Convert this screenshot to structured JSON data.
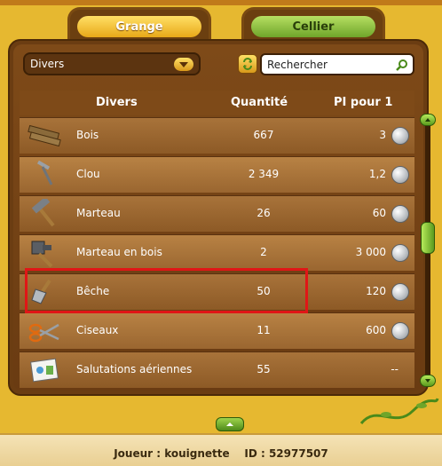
{
  "tabs": [
    {
      "label": "Grange",
      "active": true
    },
    {
      "label": "Cellier",
      "active": false
    }
  ],
  "filter": {
    "selected": "Divers"
  },
  "search": {
    "placeholder": "Rechercher"
  },
  "table": {
    "headers": {
      "name": "Divers",
      "quantity": "Quantité",
      "price": "PI pour 1"
    },
    "rows": [
      {
        "name": "Bois",
        "quantity": "667",
        "price": "3",
        "icon": "wood-planks-icon"
      },
      {
        "name": "Clou",
        "quantity": "2 349",
        "price": "1,2",
        "icon": "nail-icon"
      },
      {
        "name": "Marteau",
        "quantity": "26",
        "price": "60",
        "icon": "hammer-icon"
      },
      {
        "name": "Marteau en bois",
        "quantity": "2",
        "price": "3 000",
        "icon": "mallet-icon"
      },
      {
        "name": "Bêche",
        "quantity": "50",
        "price": "120",
        "icon": "spade-icon",
        "highlighted": true
      },
      {
        "name": "Ciseaux",
        "quantity": "11",
        "price": "600",
        "icon": "scissors-icon"
      },
      {
        "name": "Salutations aériennes",
        "quantity": "55",
        "price": "--",
        "icon": "postcard-icon"
      }
    ]
  },
  "scrollbar": {
    "position": 0.4
  },
  "footer": {
    "player_text": "Joueur : kouignette    ID : 52977507"
  },
  "colors": {
    "highlight": "#e01616",
    "wood_dark": "#6b3d12",
    "gold": "#e6b830",
    "green": "#6fa52a"
  }
}
